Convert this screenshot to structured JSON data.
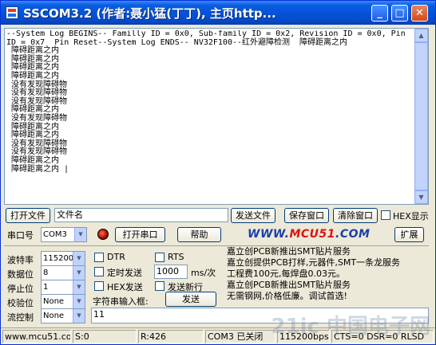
{
  "window": {
    "title": "SSCOM3.2 (作者:聂小猛(丁丁), 主页http...",
    "buttons": {
      "minimize": "_",
      "maximize": "□",
      "close": "✕"
    }
  },
  "receive": {
    "text": "--System Log BEGINS-- Familly ID = 0x0, Sub-family ID = 0x2, Revision ID = 0x0, Pin ID = 0x7  Pin Reset--System Log ENDS-- NV32F100--红外避障检测  障碍距离之内\n 障碍距离之内\n 障碍距离之内\n 障碍距离之内\n 障碍距离之内\n 没有发现障碍物\n 没有发现障碍物\n 没有发现障碍物\n 障碍距离之内\n 没有发现障碍物\n 障碍距离之内\n 障碍距离之内\n 没有发现障碍物\n 没有发现障碍物\n 障碍距离之内\n 障碍距离之内 |"
  },
  "row1": {
    "open_file": "打开文件",
    "filename": "文件名",
    "send_file": "发送文件",
    "save_window": "保存窗口",
    "clear_window": "清除窗口",
    "hex_display": "HEX显示"
  },
  "row2": {
    "port_label": "串口号",
    "port_value": "COM3",
    "open_port": "打开串口",
    "help": "帮助",
    "logo_a": "WWW.",
    "logo_b": "MCU51",
    "logo_c": ".COM",
    "expand": "扩展"
  },
  "settings": {
    "baud_label": "波特率",
    "baud_value": "115200",
    "databits_label": "数据位",
    "databits_value": "8",
    "stopbits_label": "停止位",
    "stopbits_value": "1",
    "parity_label": "校验位",
    "parity_value": "None",
    "flow_label": "流控制",
    "flow_value": "None"
  },
  "options": {
    "dtr": "DTR",
    "rts": "RTS",
    "timed_send": "定时发送",
    "interval_value": "1000",
    "interval_unit": "ms/次",
    "hex_send": "HEX发送",
    "send_newline": "发送新行",
    "input_label": "字符串输入框:",
    "send_button": "发送",
    "send_text": "11"
  },
  "ads": [
    "嘉立创PCB新推出SMT贴片服务",
    "嘉立创提供PCB打样,元器件,SMT一条龙服务",
    "工程费100元,每焊盘0.03元。",
    "嘉立创PCB新推出SMT贴片服务",
    "无需钢网,价格低廉。调试首选!"
  ],
  "status": {
    "site": "www.mcu51.cor",
    "sent": "S:0",
    "received": "R:426",
    "port_state": "COM3 已关闭",
    "baud": "115200bps",
    "lines": "CTS=0 DSR=0 RLSD"
  },
  "watermark": "21ic 中国电子网"
}
